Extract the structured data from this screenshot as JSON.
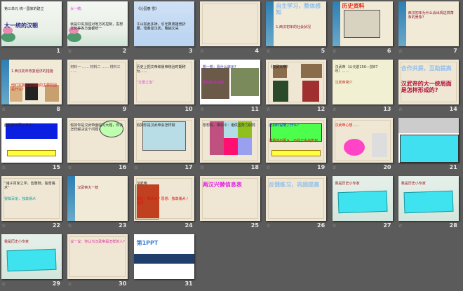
{
  "view": "slide-sorter",
  "slides": [
    {
      "n": "1",
      "bg": "lotus",
      "trans": false,
      "lines": [
        {
          "text": "第三单元 统一国家的建立",
          "c": "#223"
        },
        {
          "text": "大一统的汉朝",
          "c": "#2a2a8a",
          "big": true
        }
      ]
    },
    {
      "n": "2",
      "bg": "lotus",
      "trans": true,
      "lines": [
        {
          "text": "大一统:",
          "c": "#e020e0"
        },
        {
          "text": "就是中央加强对地方的控制，思想文化等各方面都统一",
          "c": "#222"
        }
      ]
    },
    {
      "n": "3",
      "bg": "sky",
      "trans": false,
      "lines": [
        {
          "text": "《沁园春 雪》",
          "c": "#222"
        },
        {
          "text": "江山如此多娇，引无数英雄竞折腰。惜秦皇汉武，略输文采",
          "c": "#222"
        }
      ]
    },
    {
      "n": "4",
      "bg": "parch",
      "trans": true,
      "lines": [
        {
          "text": "",
          "c": "#222"
        }
      ]
    },
    {
      "n": "5",
      "bg": "side",
      "trans": true,
      "lines": [
        {
          "text": "自主学习，整体感知",
          "c": "#8fc0ef",
          "big": true
        },
        {
          "text": "1.西汉初年的社会状况",
          "c": "#8a1030"
        }
      ]
    },
    {
      "n": "6",
      "bg": "side",
      "trans": true,
      "lines": [
        {
          "text": "历史资料",
          "c": "#e0301a",
          "big": true
        }
      ]
    },
    {
      "n": "7",
      "bg": "side",
      "trans": true,
      "lines": [
        {
          "text": "西汉初年为什么会出现这样萧条的景象?",
          "c": "#8a1030"
        }
      ]
    },
    {
      "n": "8",
      "bg": "side",
      "trans": true,
      "lines": [
        {
          "text": "1.西汉初年恢复经济的措施",
          "c": "#8a1030"
        },
        {
          "text": "他们实施这些措施的主要原因是什么?",
          "c": "#e02020"
        }
      ]
    },
    {
      "n": "9",
      "bg": "parch",
      "trans": false,
      "lines": [
        {
          "text": "材料一 …… 材料二 …… 材料三 ……",
          "c": "#444"
        }
      ]
    },
    {
      "n": "10",
      "bg": "parch",
      "trans": false,
      "lines": [
        {
          "text": "历史上把文帝和景帝统治时期称为……",
          "c": "#222"
        },
        {
          "text": "“文景之治”",
          "c": "#e040d0"
        }
      ]
    },
    {
      "n": "11",
      "bg": "white",
      "trans": true,
      "lines": [
        {
          "text": "想一想：看什么启示?",
          "c": "#2a2a9a"
        },
        {
          "text": "秦始皇兵马俑",
          "c": "#e020e0"
        }
      ]
    },
    {
      "n": "12",
      "bg": "parch",
      "trans": true,
      "lines": [
        {
          "text": "《汉武大帝》",
          "c": "#222"
        }
      ]
    },
    {
      "n": "13",
      "bg": "cream",
      "trans": true,
      "lines": [
        {
          "text": "汉武帝（公元前156—前87年）……",
          "c": "#333"
        },
        {
          "text": "汉武帝简介",
          "c": "#c03020"
        }
      ]
    },
    {
      "n": "14",
      "bg": "parch",
      "trans": true,
      "lines": [
        {
          "text": "合作共探，互助提高",
          "c": "#8fc0ef",
          "big": true
        },
        {
          "text": "汉武帝的大一统局面是怎样形成的?",
          "c": "#b0103a",
          "big": true
        }
      ]
    },
    {
      "n": "15",
      "bg": "white",
      "trans": true,
      "lines": [
        {
          "text": "此材料说明了什么?",
          "c": "#222"
        }
      ]
    },
    {
      "n": "16",
      "bg": "parch",
      "trans": true,
      "lines": [
        {
          "text": "假如你是汉武帝面临的大题，你会怎样解决这个问题?",
          "c": "#333"
        }
      ]
    },
    {
      "n": "17",
      "bg": "parch",
      "trans": true,
      "lines": [
        {
          "text": "假如你是汉武帝会怎样做",
          "c": "#333"
        }
      ]
    },
    {
      "n": "18",
      "bg": "parch",
      "trans": true,
      "lines": [
        {
          "text": "想想看，推恩令：诸侯国势力削弱",
          "c": "#333"
        }
      ]
    },
    {
      "n": "19",
      "bg": "parch",
      "trans": true,
      "lines": [
        {
          "text": "此材料说明了什么?",
          "c": "#1a1ae0"
        },
        {
          "text": "诸侯的不服从，不利于中央集权",
          "c": "#e01010"
        }
      ]
    },
    {
      "n": "20",
      "bg": "parch",
      "trans": true,
      "lines": [
        {
          "text": "汉武帝心想……",
          "c": "#e01010"
        }
      ]
    },
    {
      "n": "21",
      "bg": "white",
      "trans": false,
      "lines": [
        {
          "text": "",
          "c": "#222"
        }
      ]
    },
    {
      "n": "22",
      "bg": "parch",
      "trans": true,
      "lines": [
        {
          "text": "“诸子百家之学，皆罢黜，独尊儒术”",
          "c": "#333"
        },
        {
          "text": "罢黜百家，独尊儒术",
          "c": "#20a0a0"
        }
      ]
    },
    {
      "n": "23",
      "bg": "side",
      "trans": true,
      "lines": [
        {
          "text": "汉武帝大一统",
          "c": "#8a1030"
        }
      ]
    },
    {
      "n": "24",
      "bg": "parch",
      "trans": false,
      "lines": [
        {
          "text": "汉武帝",
          "c": "#222"
        },
        {
          "text": "政治：推恩令 / 思想：独尊儒术 / 经济",
          "c": "#e01010"
        }
      ]
    },
    {
      "n": "25",
      "bg": "parch",
      "trans": false,
      "lines": [
        {
          "text": "两汉兴替信息表",
          "c": "#e020e0",
          "big": true
        }
      ]
    },
    {
      "n": "26",
      "bg": "parch",
      "trans": true,
      "lines": [
        {
          "text": "反馈练习，巩固提高",
          "c": "#8fc0ef",
          "big": true
        }
      ]
    },
    {
      "n": "27",
      "bg": "teal",
      "trans": true,
      "lines": [
        {
          "text": "我是历史小专家",
          "c": "#a01010"
        }
      ]
    },
    {
      "n": "28",
      "bg": "teal",
      "trans": true,
      "lines": [
        {
          "text": "我是历史小专家",
          "c": "#a01010"
        }
      ]
    },
    {
      "n": "29",
      "bg": "teal",
      "trans": true,
      "lines": [
        {
          "text": "我是历史小专家",
          "c": "#a01010"
        }
      ]
    },
    {
      "n": "30",
      "bg": "parch",
      "trans": true,
      "lines": [
        {
          "text": "议一议：你认为汉武帝是怎样的人?",
          "c": "#e020a0"
        }
      ]
    },
    {
      "n": "31",
      "bg": "white",
      "trans": false,
      "lines": [
        {
          "text": "第1PPT",
          "c": "#3a7fd0",
          "big": true
        }
      ]
    }
  ],
  "transition_icon": "slide-transition-icon"
}
